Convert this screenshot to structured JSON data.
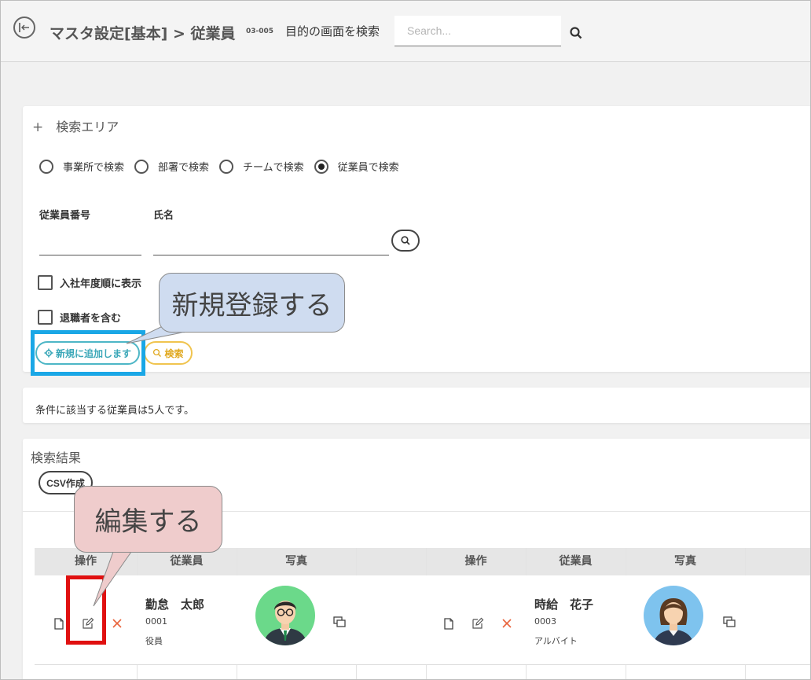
{
  "header": {
    "title": "マスタ設定[基本] > 従業員",
    "code": "03-005",
    "search_label": "目的の画面を検索",
    "search_placeholder": "Search..."
  },
  "search_area": {
    "title": "検索エリア",
    "radios": [
      {
        "label": "事業所で検索",
        "checked": false
      },
      {
        "label": "部署で検索",
        "checked": false
      },
      {
        "label": "チームで検索",
        "checked": false
      },
      {
        "label": "従業員で検索",
        "checked": true
      }
    ],
    "employee_number_label": "従業員番号",
    "name_label": "氏名",
    "checkbox_join_year": "入社年度順に表示",
    "checkbox_retired": "退職者を含む",
    "new_button": "新規に追加します",
    "search_button": "検索"
  },
  "count_text": "条件に該当する従業員は5人です。",
  "results": {
    "title": "検索結果",
    "csv_button": "CSV作成",
    "columns": [
      "操作",
      "従業員",
      "写真"
    ],
    "rows": [
      {
        "name": "勤怠　太郎",
        "id": "0001",
        "role": "役員"
      },
      {
        "name": "時給　花子",
        "id": "0003",
        "role": "アルバイト"
      }
    ]
  },
  "callouts": {
    "new": "新規登録する",
    "edit": "編集する"
  },
  "colors": {
    "highlight_blue": "#1aa7e6",
    "highlight_red": "#e01010",
    "new_button": "#4db6c6",
    "search_button": "#f0c44f",
    "delete_icon": "#e8643c"
  }
}
